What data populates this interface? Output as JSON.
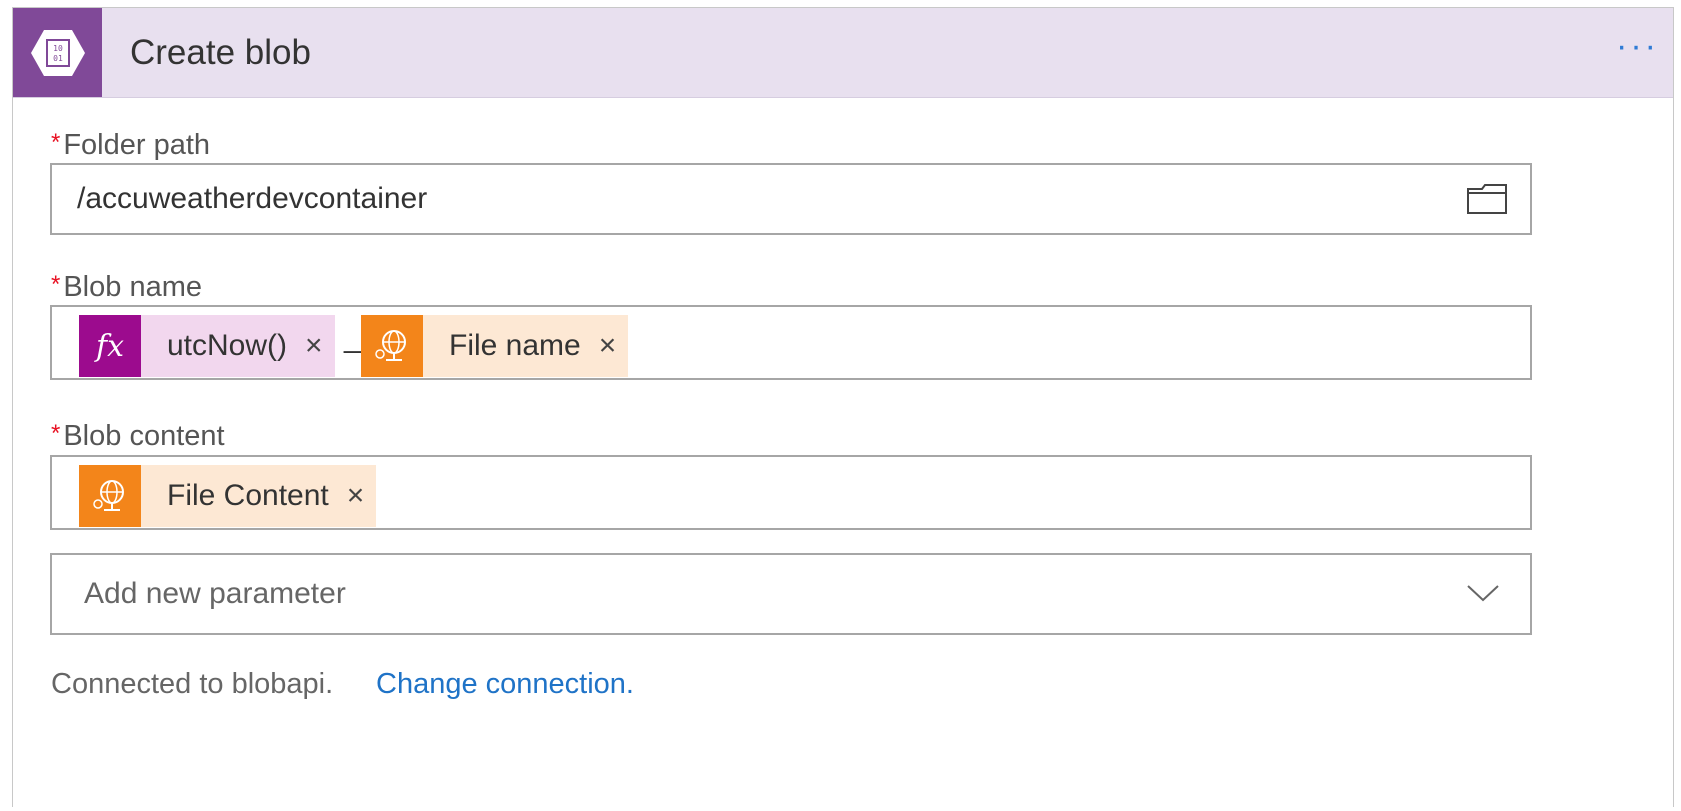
{
  "header": {
    "title": "Create blob",
    "more_label": "···",
    "icon": "blob-storage-icon",
    "accent": "#804998",
    "background": "#e8e0ef"
  },
  "fields": {
    "folder_path": {
      "required_mark": "*",
      "label": "Folder path",
      "value": "/accuweatherdevcontainer",
      "icon": "folder-icon"
    },
    "blob_name": {
      "required_mark": "*",
      "label": "Blob name",
      "tokens": [
        {
          "icon_text": "fx",
          "label": "utcNow()",
          "remove": "×",
          "color": "#9c0b8e",
          "bg": "#f2d7ee"
        },
        {
          "icon": "web-connector-icon",
          "label": "File name",
          "remove": "×",
          "color": "#f3851a",
          "bg": "#fde8d4"
        }
      ],
      "separator": "_"
    },
    "blob_content": {
      "required_mark": "*",
      "label": "Blob content",
      "tokens": [
        {
          "icon": "web-connector-icon",
          "label": "File Content",
          "remove": "×",
          "color": "#f3851a",
          "bg": "#fde8d4"
        }
      ]
    }
  },
  "add_parameter": {
    "placeholder": "Add new parameter",
    "icon": "chevron-down-icon"
  },
  "footer": {
    "connection_text": "Connected to blobapi.",
    "change_link": "Change connection."
  }
}
